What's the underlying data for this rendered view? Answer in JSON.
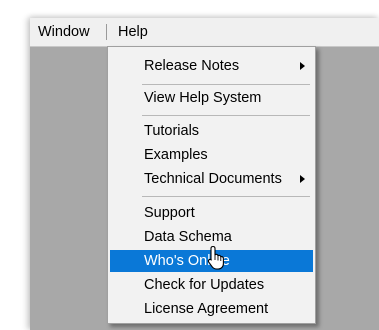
{
  "menubar": {
    "window_label": "Window",
    "help_label": "Help"
  },
  "help_menu": {
    "items": [
      {
        "label": "Release Notes",
        "has_submenu": true
      },
      {
        "label": "View Help System",
        "has_submenu": false
      },
      {
        "label": "Tutorials",
        "has_submenu": false
      },
      {
        "label": "Examples",
        "has_submenu": false
      },
      {
        "label": "Technical Documents",
        "has_submenu": true
      },
      {
        "label": "Support",
        "has_submenu": false
      },
      {
        "label": "Data Schema",
        "has_submenu": false
      },
      {
        "label": "Who's Online",
        "has_submenu": false,
        "highlighted": true
      },
      {
        "label": "Check for Updates",
        "has_submenu": false
      },
      {
        "label": "License Agreement",
        "has_submenu": false
      }
    ]
  },
  "colors": {
    "highlight": "#0a78d7",
    "menu_background": "#f2f2f2",
    "workspace": "#a8a8a8"
  },
  "icons": {
    "cursor": "mouse-pointer-hand-icon",
    "submenu": "chevron-right-icon"
  }
}
